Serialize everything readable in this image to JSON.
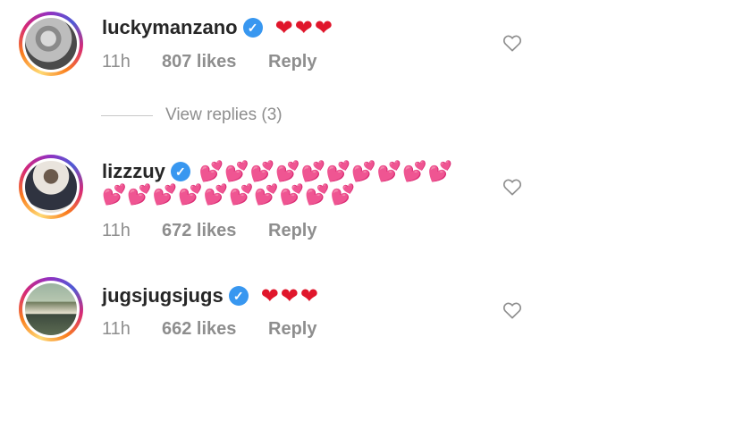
{
  "comments": [
    {
      "username": "luckymanzano",
      "verified_icon": "verified-badge-icon",
      "text": "❤❤❤",
      "text_line2": "",
      "time": "11h",
      "likes": "807 likes",
      "reply": "Reply",
      "like_icon": "heart-outline-icon"
    },
    {
      "username": "lizzzuy",
      "verified_icon": "verified-badge-icon",
      "text": "💕💕💕💕💕💕💕💕💕💕",
      "text_line2": "💕💕💕💕💕💕💕💕💕💕",
      "time": "11h",
      "likes": "672 likes",
      "reply": "Reply",
      "like_icon": "heart-outline-icon"
    },
    {
      "username": "jugsjugsjugs",
      "verified_icon": "verified-badge-icon",
      "text": "❤❤❤",
      "text_line2": "",
      "time": "11h",
      "likes": "662 likes",
      "reply": "Reply",
      "like_icon": "heart-outline-icon"
    }
  ],
  "view_replies": "View replies (3)",
  "colors": {
    "verified": "#3897f0",
    "heart": "#e0162b",
    "meta_text": "#8e8e8e",
    "username": "#262626"
  }
}
